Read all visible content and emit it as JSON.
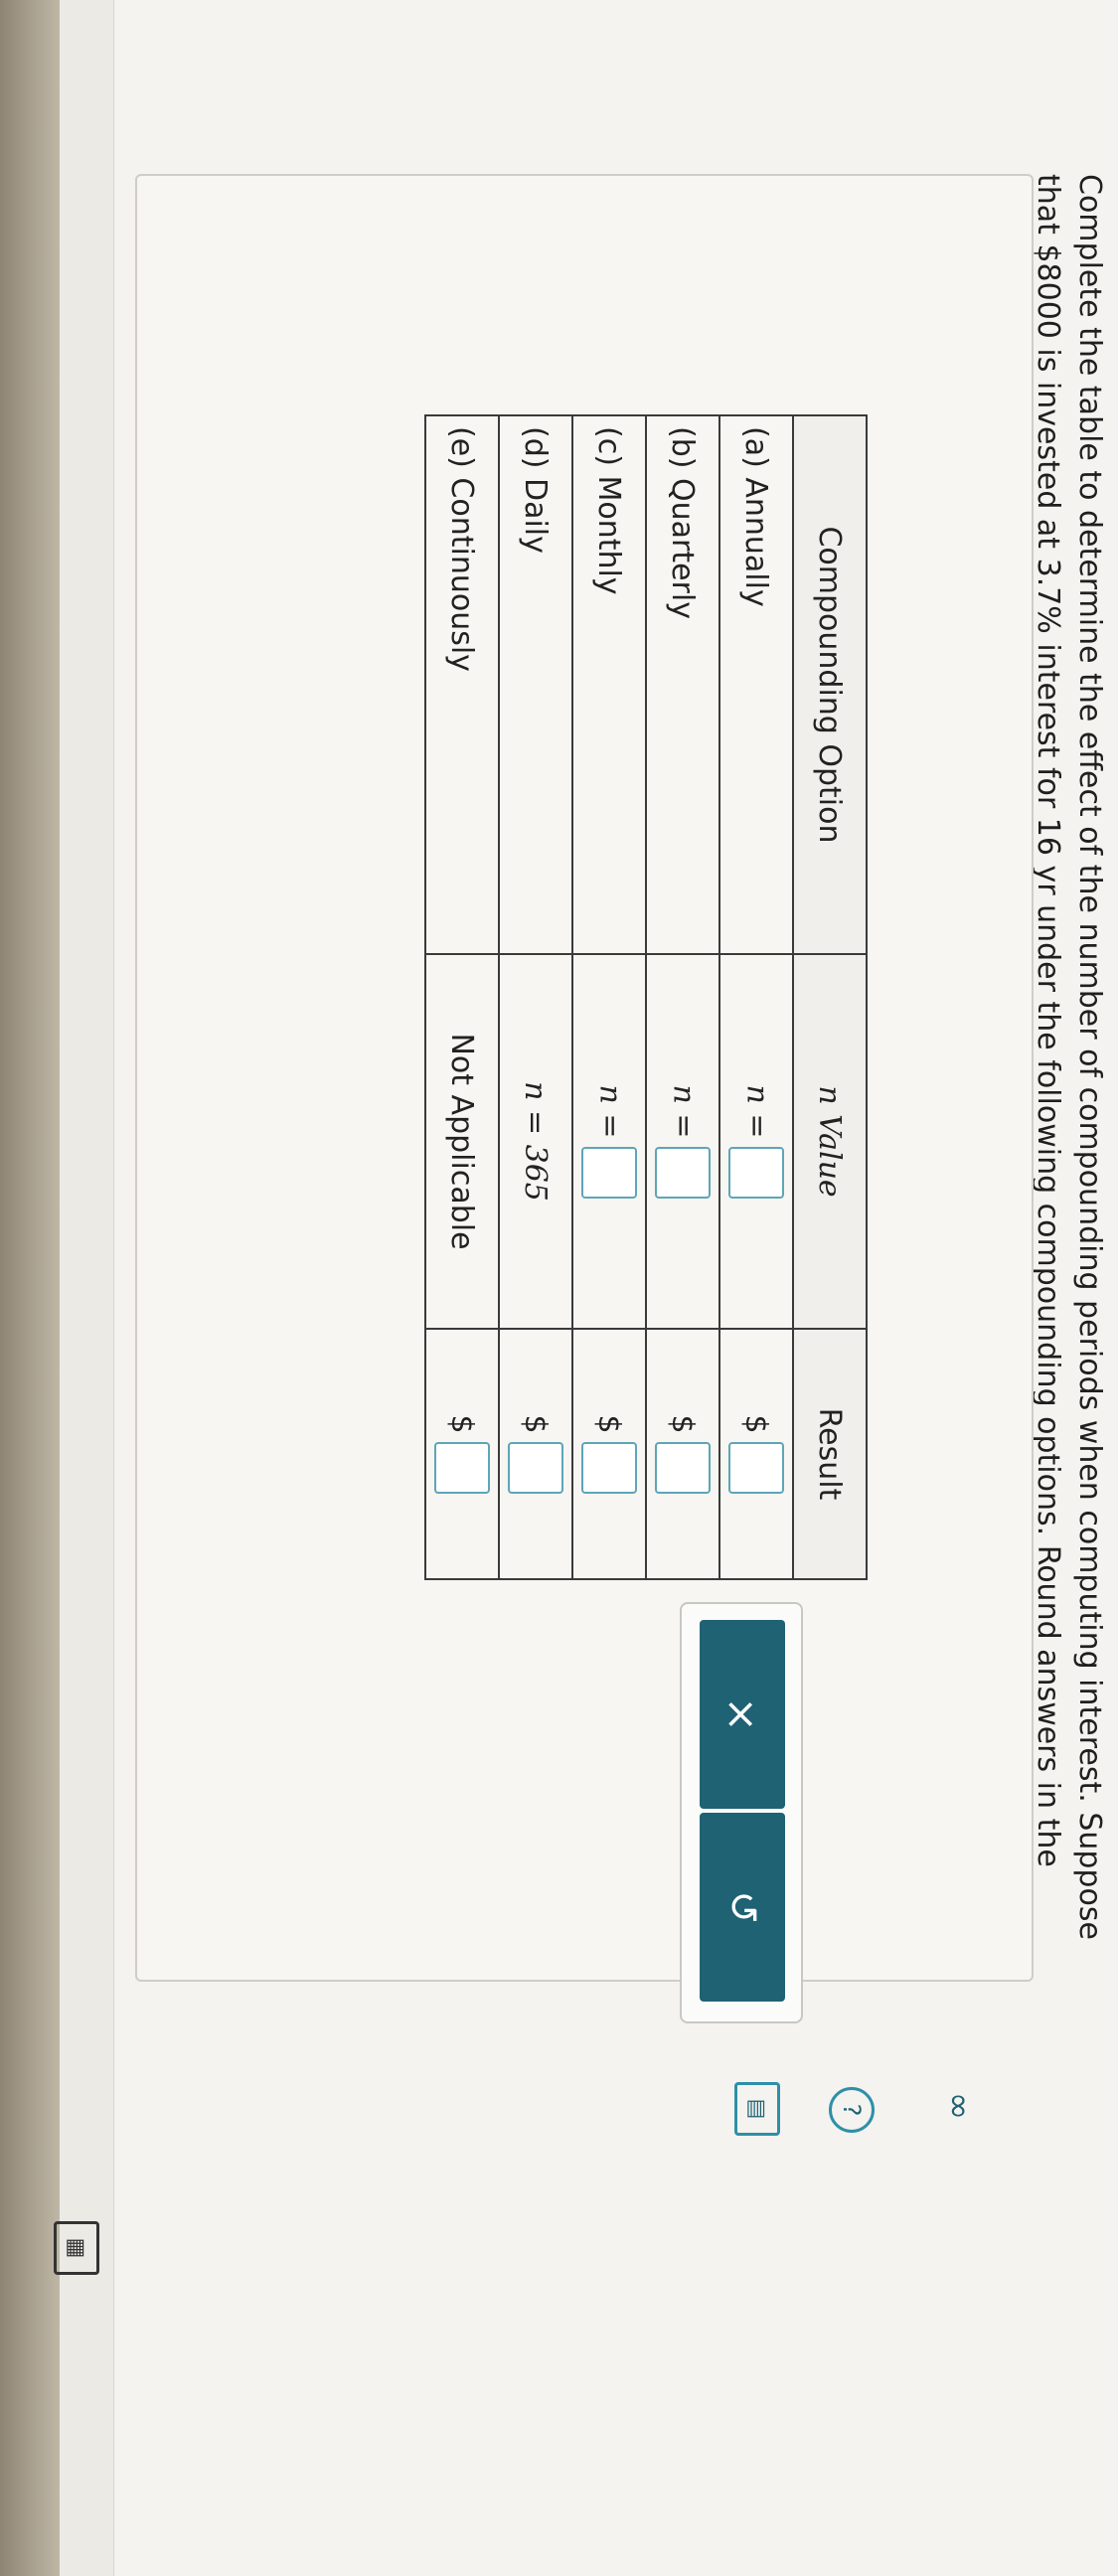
{
  "prompt": "Complete the table to determine the effect of the number of compounding periods when computing interest. Suppose that $8000 is invested at 3.7% interest for 16 yr under the following compounding options. Round answers in the second column to the nearest whole number. Round answers in the last column to the nearest cent.",
  "table": {
    "headers": [
      "Compounding Option",
      "n Value",
      "Result"
    ],
    "rows": [
      {
        "option": "(a) Annually",
        "n_prefix": "n =",
        "n_value": "",
        "result_prefix": "$",
        "result_value": ""
      },
      {
        "option": "(b) Quarterly",
        "n_prefix": "n =",
        "n_value": "",
        "result_prefix": "$",
        "result_value": ""
      },
      {
        "option": "(c) Monthly",
        "n_prefix": "n =",
        "n_value": "",
        "result_prefix": "$",
        "result_value": ""
      },
      {
        "option": "(d) Daily",
        "n_text": "n = 365",
        "result_prefix": "$",
        "result_value": ""
      },
      {
        "option": "(e) Continuously",
        "n_text": "Not Applicable",
        "result_prefix": "$",
        "result_value": ""
      }
    ]
  },
  "buttons": {
    "clear_icon": "×",
    "undo_icon": "↺"
  },
  "icons": {
    "infinity": "∞",
    "help": "?",
    "textbook": "▤",
    "calculator": "▦"
  },
  "colors": {
    "accent": "#1f6273",
    "input_border": "#5ea5b8"
  }
}
